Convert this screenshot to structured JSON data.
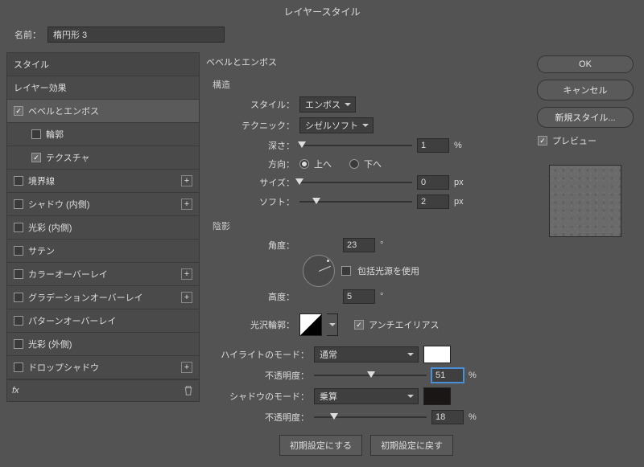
{
  "title": "レイヤースタイル",
  "name_label": "名前：",
  "name_value": "楕円形 3",
  "styles_header": "スタイル",
  "effects_header": "レイヤー効果",
  "style_items": [
    {
      "label": "ベベルとエンボス",
      "checked": true,
      "selected": true,
      "plus": false,
      "sub": false
    },
    {
      "label": "輪郭",
      "checked": false,
      "selected": false,
      "plus": false,
      "sub": true
    },
    {
      "label": "テクスチャ",
      "checked": true,
      "selected": false,
      "plus": false,
      "sub": true
    },
    {
      "label": "境界線",
      "checked": false,
      "selected": false,
      "plus": true,
      "sub": false
    },
    {
      "label": "シャドウ (内側)",
      "checked": false,
      "selected": false,
      "plus": true,
      "sub": false
    },
    {
      "label": "光彩 (内側)",
      "checked": false,
      "selected": false,
      "plus": false,
      "sub": false
    },
    {
      "label": "サテン",
      "checked": false,
      "selected": false,
      "plus": false,
      "sub": false
    },
    {
      "label": "カラーオーバーレイ",
      "checked": false,
      "selected": false,
      "plus": true,
      "sub": false
    },
    {
      "label": "グラデーションオーバーレイ",
      "checked": false,
      "selected": false,
      "plus": true,
      "sub": false
    },
    {
      "label": "パターンオーバーレイ",
      "checked": false,
      "selected": false,
      "plus": false,
      "sub": false
    },
    {
      "label": "光彩 (外側)",
      "checked": false,
      "selected": false,
      "plus": false,
      "sub": false
    },
    {
      "label": "ドロップシャドウ",
      "checked": false,
      "selected": false,
      "plus": true,
      "sub": false
    }
  ],
  "fx_label": "fx",
  "panel": {
    "title": "ベベルとエンボス",
    "structure": "構造",
    "style_label": "スタイル：",
    "style_value": "エンボス",
    "technique_label": "テクニック：",
    "technique_value": "シゼルソフト",
    "depth_label": "深さ：",
    "depth_value": "1",
    "depth_unit": "%",
    "direction_label": "方向：",
    "direction_up": "上へ",
    "direction_down": "下へ",
    "size_label": "サイズ：",
    "size_value": "0",
    "size_unit": "px",
    "soften_label": "ソフト：",
    "soften_value": "2",
    "soften_unit": "px",
    "shading": "陰影",
    "angle_label": "角度：",
    "angle_value": "23",
    "global_light": "包括光源を使用",
    "altitude_label": "高度：",
    "altitude_value": "5",
    "gloss_label": "光沢輪郭：",
    "antialias": "アンチエイリアス",
    "highlight_mode_label": "ハイライトのモード：",
    "highlight_mode_value": "通常",
    "opacity_label": "不透明度：",
    "highlight_opacity": "51",
    "shadow_mode_label": "シャドウのモード：",
    "shadow_mode_value": "乗算",
    "shadow_opacity": "18",
    "pct": "%",
    "degree": "°",
    "default_set": "初期設定にする",
    "default_reset": "初期設定に戻す"
  },
  "buttons": {
    "ok": "OK",
    "cancel": "キャンセル",
    "new_style": "新規スタイル...",
    "preview": "プレビュー"
  }
}
